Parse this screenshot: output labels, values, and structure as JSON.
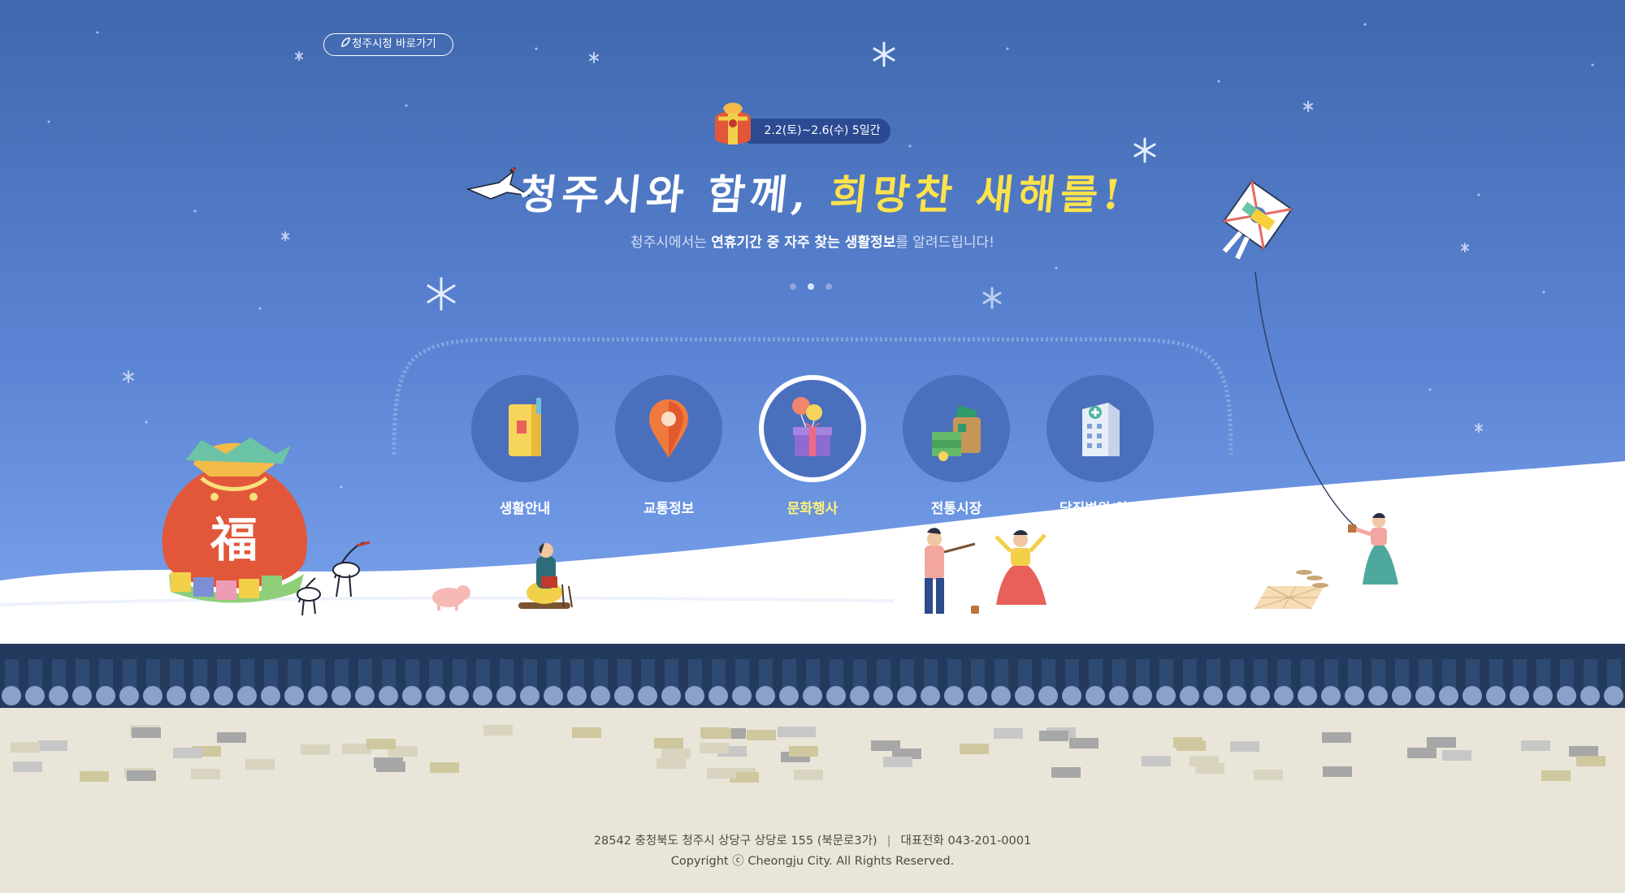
{
  "header": {
    "site_link_label": "청주시청 바로가기"
  },
  "banner": {
    "period": "2.2(토)~2.6(수) 5일간",
    "headline_part1": "청주시와 함께,",
    "headline_part2": "희망찬 새해를!",
    "subtitle_part1": "청주시에서는",
    "subtitle_bold": "연휴기간 중 자주 찾는 생활정보",
    "subtitle_part2": "를 알려드립니다!",
    "pouch_character": "福"
  },
  "slider": {
    "dot_count": 3,
    "active_dot": 1
  },
  "menu": {
    "items": [
      {
        "label": "생활안내",
        "icon": "book-icon",
        "active": false
      },
      {
        "label": "교통정보",
        "icon": "map-pin-icon",
        "active": false
      },
      {
        "label": "문화행사",
        "icon": "gift-balloon-icon",
        "active": true
      },
      {
        "label": "전통시장",
        "icon": "money-shopping-bag-icon",
        "active": false
      },
      {
        "label": "당직병원/약국",
        "icon": "hospital-icon",
        "active": false
      }
    ]
  },
  "footer": {
    "address": "28542 충청북도 청주시 상당구 상당로 155 (북문로3가)",
    "separator": "|",
    "phone": "대표전화 043-201-0001",
    "copyright": "Copyright ⓒ Cheongju City. All Rights Reserved."
  },
  "colors": {
    "sky_top": "#4068ae",
    "sky_bottom": "#79a1ea",
    "menu_circle": "#4a6fbd",
    "active_label": "#fff27a",
    "headline_accent": "#fce34b",
    "roof": "#243a5c",
    "wall": "#e9e5d8"
  }
}
